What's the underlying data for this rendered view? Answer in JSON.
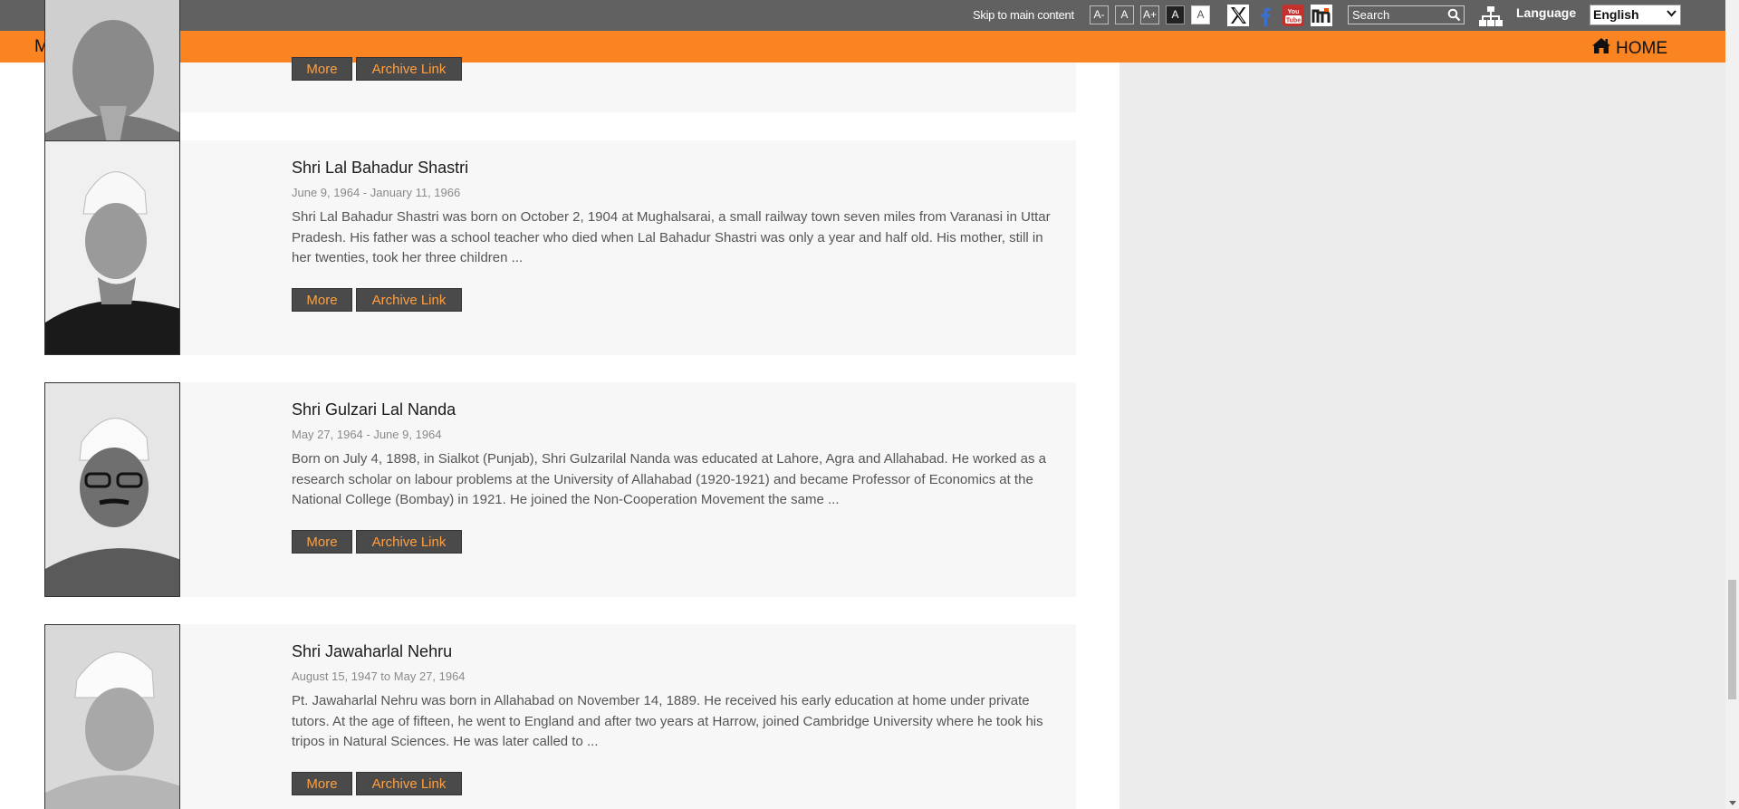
{
  "topbar": {
    "skip_link": "Skip to main content",
    "font_sizes": [
      "A-",
      "A",
      "A+",
      "A",
      "A"
    ],
    "social": [
      "x-icon",
      "facebook-icon",
      "youtube-icon",
      "mygov-icon"
    ],
    "search_placeholder": "Search",
    "language_label": "Language",
    "language_selected": "English"
  },
  "nav": {
    "menu_label": "MENU",
    "home_label": "HOME"
  },
  "colors": {
    "topbar": "#616161",
    "nav": "#fa8421",
    "button_bg": "#4a4a4a",
    "button_text": "#ffa040",
    "card_bg": "#f7f7f7",
    "sidebar": "#ececec"
  },
  "top_partial": {
    "more_label": "More",
    "archive_label": "Archive Link"
  },
  "pms": [
    {
      "name": "Shri Lal Bahadur Shastri",
      "dates": "June 9, 1964 - January 11, 1966",
      "description": "Shri Lal Bahadur Shastri was born on October 2, 1904 at Mughalsarai, a small railway town seven miles from Varanasi in Uttar Pradesh. His father was a school teacher who died when Lal Bahadur Shastri was only a year and half old. His mother, still in her twenties, took her three children ...",
      "more_label": "More",
      "archive_label": "Archive Link"
    },
    {
      "name": "Shri Gulzari Lal Nanda",
      "dates": "May 27, 1964 - June 9, 1964",
      "description": "Born on July 4, 1898, in Sialkot (Punjab), Shri Gulzarilal Nanda was educated at Lahore, Agra and Allahabad. He worked as a research scholar on labour problems at the University of Allahabad (1920-1921) and became Professor of Economics at the National College (Bombay) in 1921. He joined the Non-Cooperation Movement the same ...",
      "more_label": "More",
      "archive_label": "Archive Link"
    },
    {
      "name": "Shri Jawaharlal Nehru",
      "dates": "August 15, 1947 to May 27, 1964",
      "description": "Pt. Jawaharlal Nehru was born in Allahabad on November 14, 1889. He received his early education at home under private tutors. At the age of fifteen, he went to England and after two years at Harrow, joined Cambridge University where he took his tripos in Natural Sciences. He was later called to ...",
      "more_label": "More",
      "archive_label": "Archive Link"
    }
  ]
}
